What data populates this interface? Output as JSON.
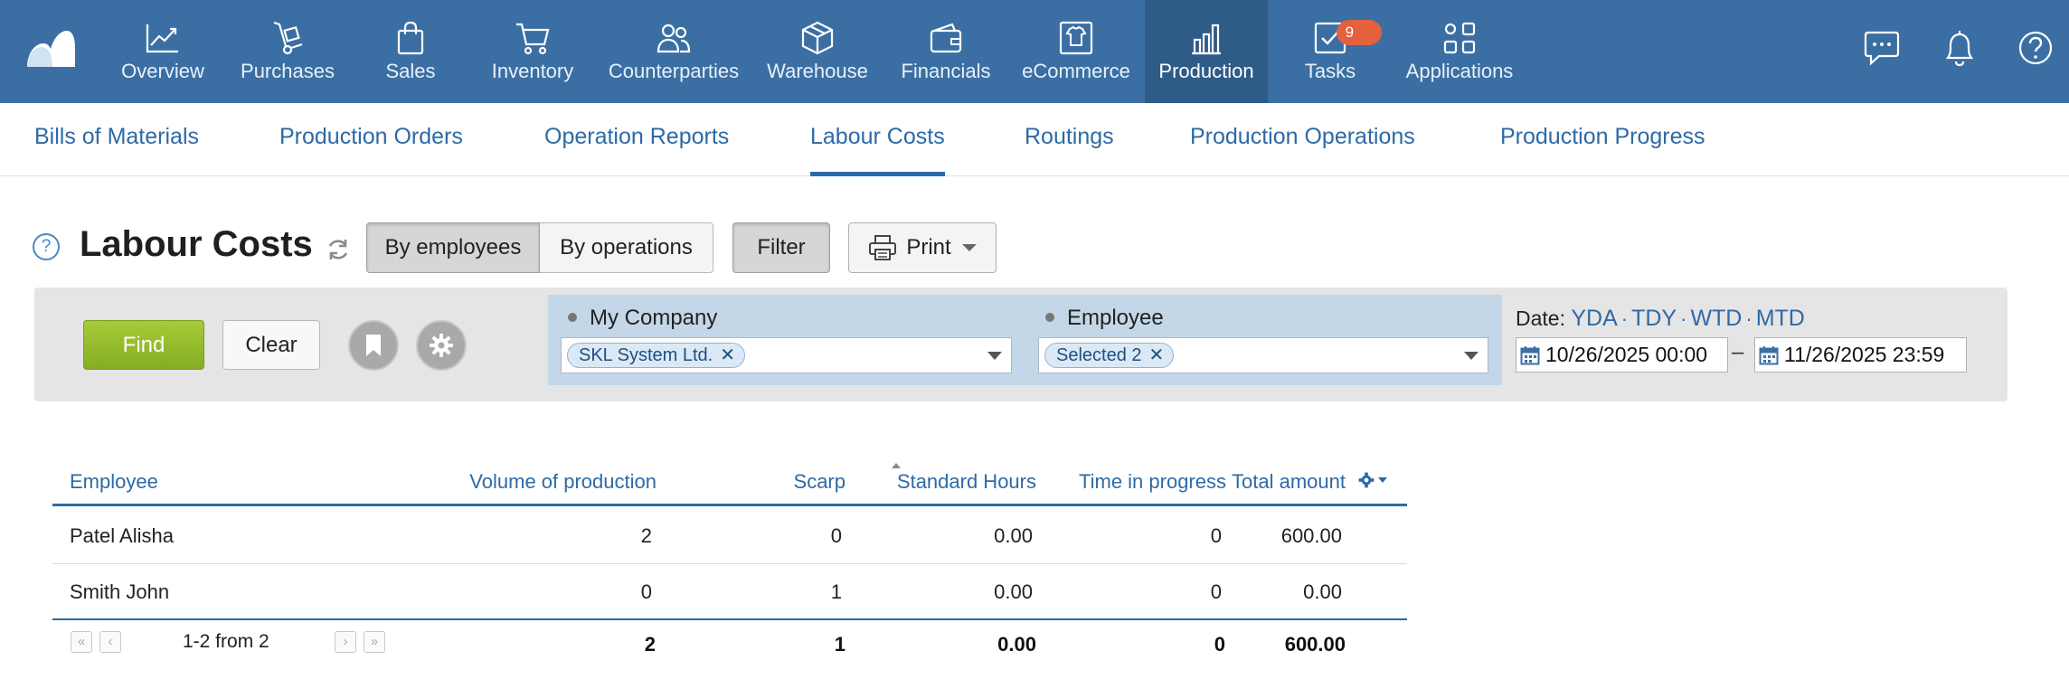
{
  "topnav": {
    "items": [
      {
        "label": "Overview",
        "icon": "chart-line-icon"
      },
      {
        "label": "Purchases",
        "icon": "hand-truck-icon"
      },
      {
        "label": "Sales",
        "icon": "shopping-bag-icon"
      },
      {
        "label": "Inventory",
        "icon": "cart-icon"
      },
      {
        "label": "Counterparties",
        "icon": "people-icon"
      },
      {
        "label": "Warehouse",
        "icon": "box-icon"
      },
      {
        "label": "Financials",
        "icon": "wallet-icon"
      },
      {
        "label": "eCommerce",
        "icon": "shirt-screen-icon"
      },
      {
        "label": "Production",
        "icon": "factory-icon",
        "active": true
      },
      {
        "label": "Tasks",
        "icon": "checkbox-icon",
        "badge": "9"
      },
      {
        "label": "Applications",
        "icon": "apps-icon"
      }
    ],
    "right_icons": [
      "chat-icon",
      "bell-icon",
      "help-icon"
    ]
  },
  "subnav": {
    "tabs": [
      {
        "label": "Bills of Materials"
      },
      {
        "label": "Production Orders"
      },
      {
        "label": "Operation Reports"
      },
      {
        "label": "Labour Costs",
        "active": true
      },
      {
        "label": "Routings"
      },
      {
        "label": "Production Operations"
      },
      {
        "label": "Production Progress"
      }
    ]
  },
  "toolbar": {
    "help": "?",
    "title": "Labour Costs",
    "by_employees": "By employees",
    "by_operations": "By operations",
    "filter": "Filter",
    "print": "Print"
  },
  "filters": {
    "find": "Find",
    "clear": "Clear",
    "company_label": "My Company",
    "company_value": "SKL System Ltd.",
    "employee_label": "Employee",
    "employee_value": "Selected 2",
    "date_label": "Date:",
    "date_shortcuts": [
      "YDA",
      "TDY",
      "WTD",
      "MTD"
    ],
    "date_from": "10/26/2025 00:00",
    "date_to": "11/26/2025 23:59",
    "date_dash": "–"
  },
  "table": {
    "columns": [
      "Employee",
      "Volume of production",
      "Scarp",
      "Standard Hours",
      "Time in progress",
      "Total amount"
    ],
    "rows": [
      [
        "Patel Alisha",
        "2",
        "0",
        "0.00",
        "0",
        "600.00"
      ],
      [
        "Smith John",
        "0",
        "1",
        "0.00",
        "0",
        "0.00"
      ]
    ],
    "totals": [
      "2",
      "1",
      "0.00",
      "0",
      "600.00"
    ],
    "pager": "1-2 from 2"
  },
  "colors": {
    "nav_bg": "#3b6fa3",
    "nav_active": "#2f5b87",
    "link": "#2d6aa6",
    "find_green": "#96bc2c",
    "badge": "#e5603d"
  }
}
